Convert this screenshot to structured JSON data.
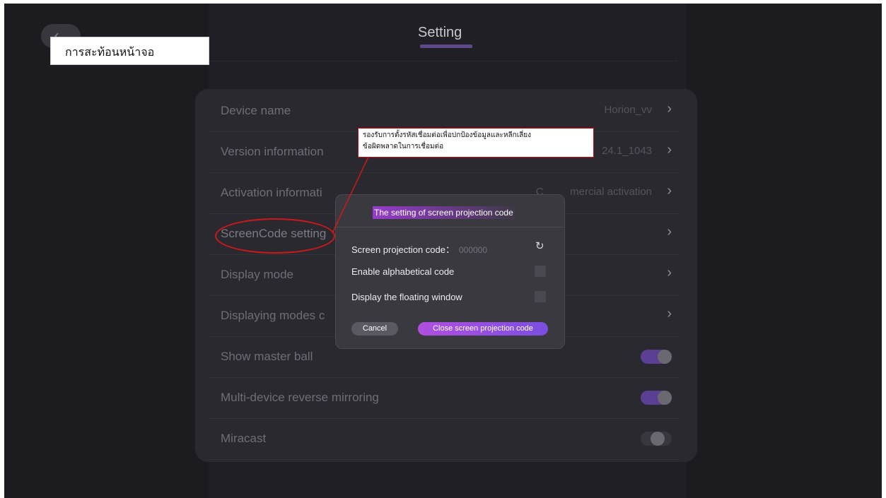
{
  "header": {
    "title": "Setting",
    "back_icon": "chevron-left-icon"
  },
  "overlay_label": "การสะท้อนหน้าจอ",
  "callout": {
    "line1": "รองรับการตั้งรหัสเชื่อมต่อเพื่อปกป้องข้อมูลและหลีกเลี่ยง",
    "line2": "ข้อผิดพลาดในการเชื่อมต่อ"
  },
  "settings": {
    "device_name": {
      "label": "Device name",
      "value": "Horion_vv"
    },
    "version": {
      "label": "Version information",
      "value": "24.1_1043"
    },
    "activation": {
      "label": "Activation informati",
      "value": "C         mercial activation"
    },
    "screencode": {
      "label": "ScreenCode setting"
    },
    "display_mode": {
      "label": "Display mode"
    },
    "displaying_modes": {
      "label": "Displaying modes c"
    },
    "master_ball": {
      "label": "Show master ball",
      "enabled": true
    },
    "reverse_mirroring": {
      "label": "Multi-device reverse mirroring",
      "enabled": true
    },
    "miracast": {
      "label": "Miracast",
      "enabled": false
    }
  },
  "dialog": {
    "title": "The setting of screen projection code",
    "code_label": "Screen projection code：",
    "code_value": "000000",
    "alphabetical_label": "Enable alphabetical code",
    "alphabetical_checked": false,
    "floating_label": "Display the floating window",
    "floating_checked": false,
    "cancel_label": "Cancel",
    "close_label": "Close screen projection code"
  },
  "colors": {
    "accent": "#5a3f94",
    "dialog_button_gradient_start": "#b04fe0",
    "annotation_red": "#d01818"
  }
}
